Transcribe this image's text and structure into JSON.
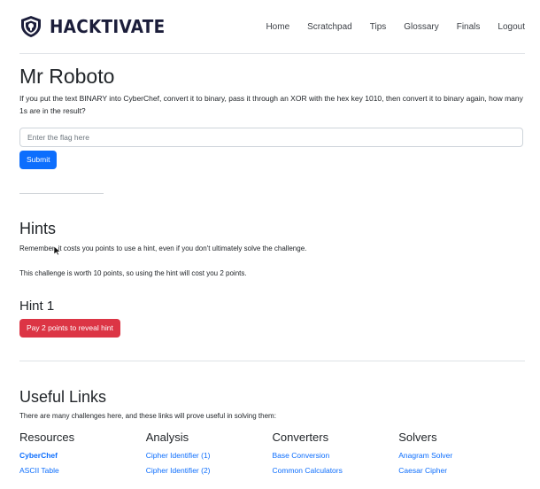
{
  "brand": {
    "name": "HACKTIVATE",
    "logo_icon": "shield-icon"
  },
  "nav": [
    "Home",
    "Scratchpad",
    "Tips",
    "Glossary",
    "Finals",
    "Logout"
  ],
  "challenge": {
    "title": "Mr Roboto",
    "question": "If you put the text BINARY into CyberChef, convert it to binary, pass it through an XOR with the hex key 1010, then convert it to binary again, how many 1s are in the result?",
    "flag_placeholder": "Enter the flag here",
    "submit_label": "Submit"
  },
  "hints": {
    "title": "Hints",
    "note": "Remember, it costs you points to use a hint, even if you don't ultimately solve the challenge.",
    "cost_note": "This challenge is worth 10 points, so using the hint will cost you 2 points.",
    "hint1_title": "Hint 1",
    "reveal_label": "Pay 2 points to reveal hint"
  },
  "links": {
    "title": "Useful Links",
    "intro": "There are many challenges here, and these links will prove useful in solving them:",
    "columns": [
      {
        "heading": "Resources",
        "items": [
          "CyberChef",
          "ASCII Table"
        ]
      },
      {
        "heading": "Analysis",
        "items": [
          "Cipher Identifier (1)",
          "Cipher Identifier (2)"
        ]
      },
      {
        "heading": "Converters",
        "items": [
          "Base Conversion",
          "Common Calculators"
        ]
      },
      {
        "heading": "Solvers",
        "items": [
          "Anagram Solver",
          "Caesar Cipher"
        ]
      }
    ]
  },
  "colors": {
    "primary": "#0d6efd",
    "danger": "#dc3545",
    "brand": "#1b1d3a"
  }
}
